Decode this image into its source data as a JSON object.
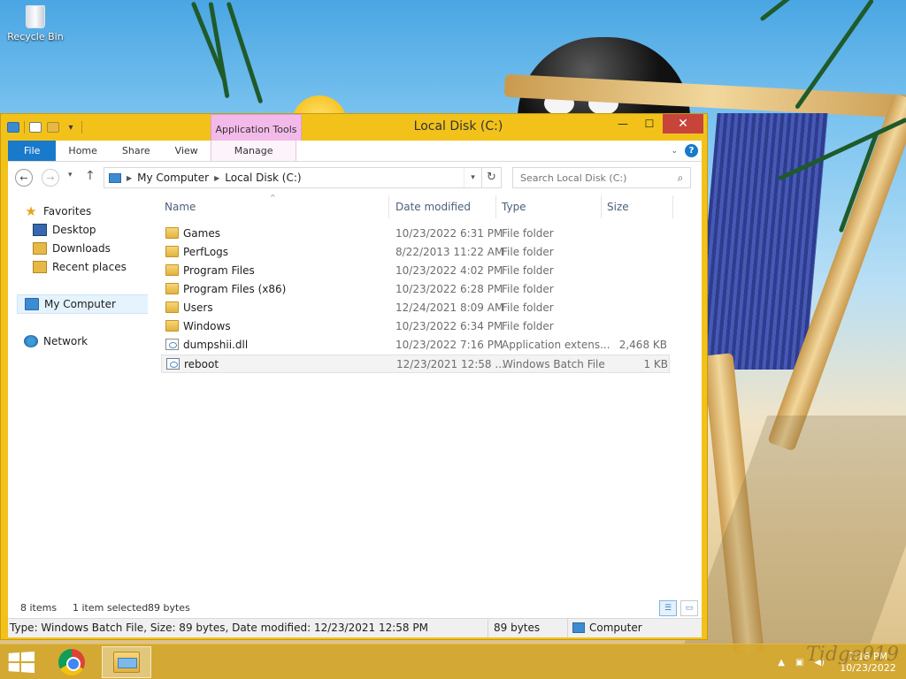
{
  "desktop": {
    "recycle_bin_label": "Recycle Bin",
    "watermark": "Tidge919"
  },
  "window": {
    "title": "Local Disk (C:)",
    "context_tab_header": "Application Tools",
    "controls": {
      "minimize": "—",
      "maximize": "☐",
      "close": "✕"
    }
  },
  "ribbon": {
    "tabs": [
      "File",
      "Home",
      "Share",
      "View",
      "Manage"
    ],
    "collapse_icon": "chevron-down-icon",
    "help_icon": "help-icon",
    "help_glyph": "?"
  },
  "address_bar": {
    "crumbs": [
      "My Computer",
      "Local Disk (C:)"
    ],
    "search_placeholder": "Search Local Disk (C:)"
  },
  "nav_pane": {
    "favorites_label": "Favorites",
    "favorites": [
      "Desktop",
      "Downloads",
      "Recent places"
    ],
    "computer_label": "My Computer",
    "network_label": "Network",
    "selected": "My Computer"
  },
  "file_list": {
    "columns": {
      "name": "Name",
      "date": "Date modified",
      "type": "Type",
      "size": "Size"
    },
    "sort_column": "Name",
    "rows": [
      {
        "name": "Games",
        "date": "10/23/2022 6:31 PM",
        "type": "File folder",
        "size": "",
        "icon": "folder-icon"
      },
      {
        "name": "PerfLogs",
        "date": "8/22/2013 11:22 AM",
        "type": "File folder",
        "size": "",
        "icon": "folder-icon"
      },
      {
        "name": "Program Files",
        "date": "10/23/2022 4:02 PM",
        "type": "File folder",
        "size": "",
        "icon": "folder-icon"
      },
      {
        "name": "Program Files (x86)",
        "date": "10/23/2022 6:28 PM",
        "type": "File folder",
        "size": "",
        "icon": "folder-icon"
      },
      {
        "name": "Users",
        "date": "12/24/2021 8:09 AM",
        "type": "File folder",
        "size": "",
        "icon": "folder-icon"
      },
      {
        "name": "Windows",
        "date": "10/23/2022 6:34 PM",
        "type": "File folder",
        "size": "",
        "icon": "folder-icon"
      },
      {
        "name": "dumpshii.dll",
        "date": "10/23/2022 7:16 PM",
        "type": "Application extens...",
        "size": "2,468 KB",
        "icon": "dll-file-icon"
      },
      {
        "name": "reboot",
        "date": "12/23/2021 12:58 ...",
        "type": "Windows Batch File",
        "size": "1 KB",
        "icon": "batch-file-icon",
        "selected": true
      }
    ]
  },
  "status": {
    "item_count": "8 items",
    "selection": "1 item selected",
    "selection_size": "89 bytes"
  },
  "details_bar": {
    "info": "Type: Windows Batch File, Size: 89 bytes, Date modified: 12/23/2021 12:58 PM",
    "size": "89 bytes",
    "location": "Computer"
  },
  "taskbar": {
    "apps": [
      "start-icon",
      "chrome-icon",
      "file-explorer-icon"
    ],
    "clock_time": "7:18 PM",
    "clock_date": "10/23/2022"
  },
  "colors": {
    "window_frame": "#f2c21a",
    "file_tab": "#1979ca",
    "context_tab": "#f3b9e9",
    "close_button": "#c7443b"
  }
}
